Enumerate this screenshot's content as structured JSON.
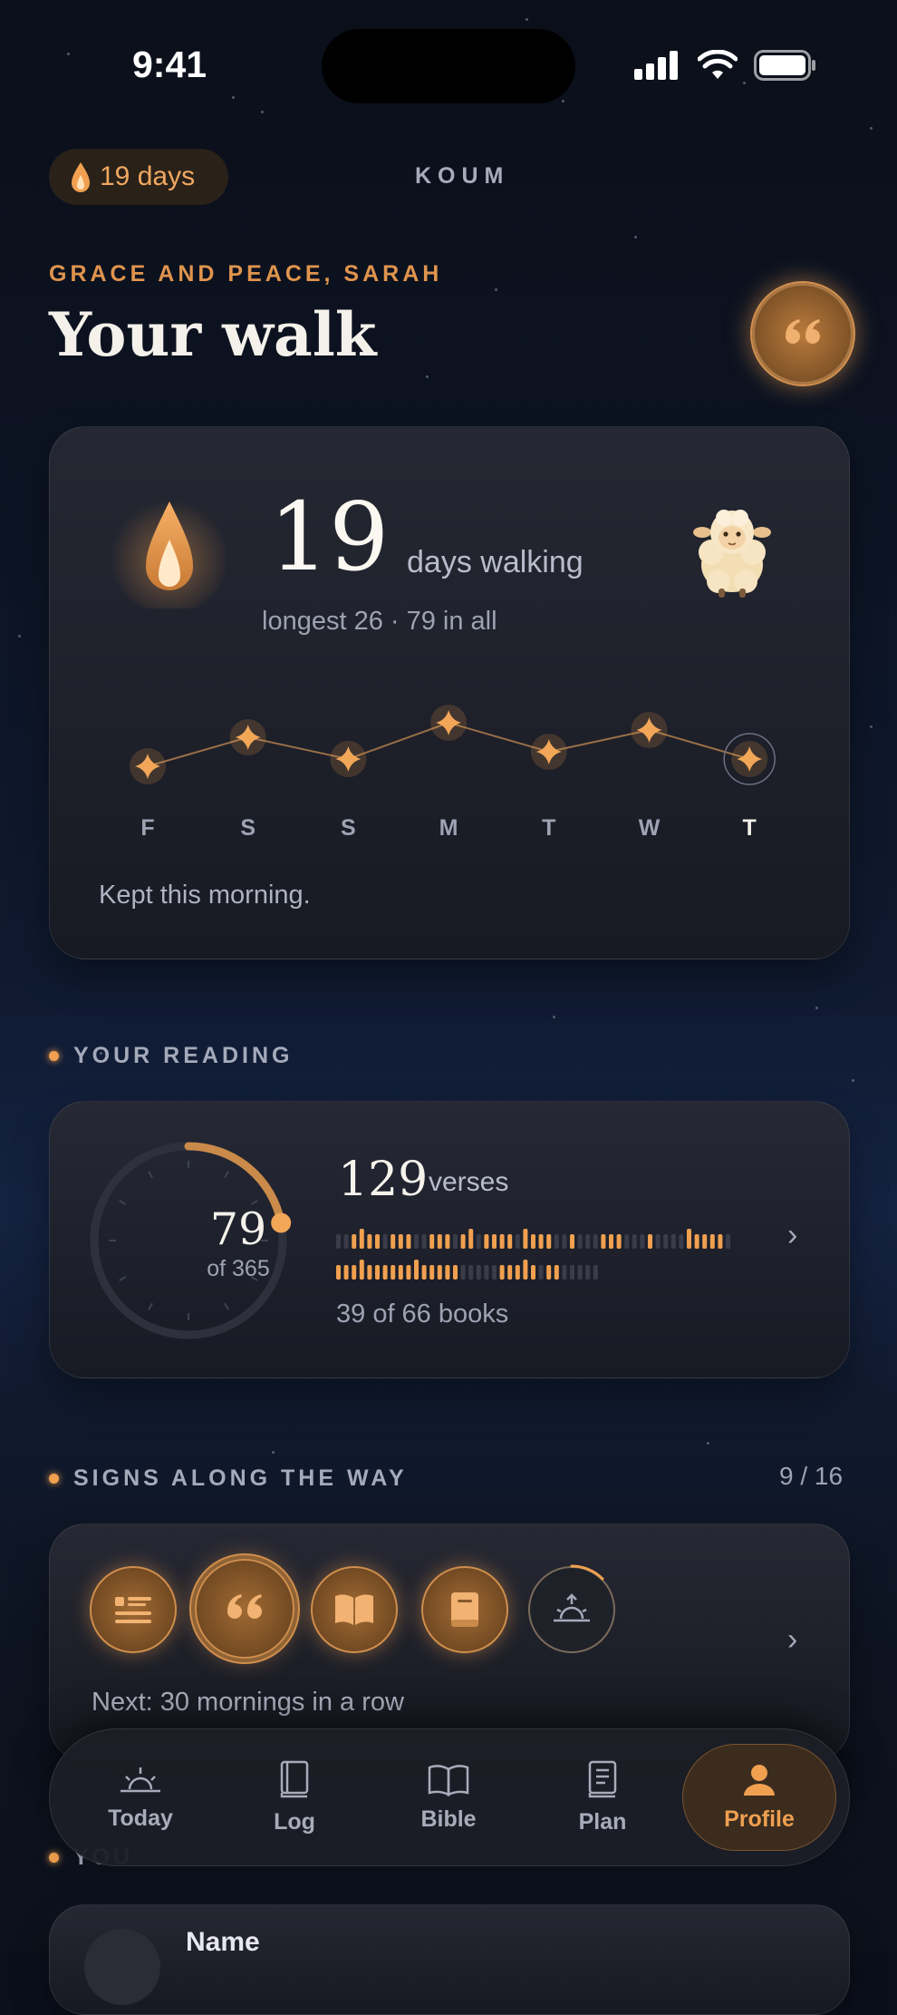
{
  "status_bar": {
    "time": "9:41"
  },
  "header": {
    "streak_label": "19 days",
    "brand": "KOUM",
    "greeting": "GRACE AND PEACE, SARAH",
    "title": "Your walk"
  },
  "walk_card": {
    "streak_number": "19",
    "streak_label": "days walking",
    "subtitle": "longest 26 · 79 in all",
    "days": [
      {
        "label": "F",
        "value": 1
      },
      {
        "label": "S",
        "value": 3
      },
      {
        "label": "S",
        "value": 1.5
      },
      {
        "label": "M",
        "value": 4
      },
      {
        "label": "T",
        "value": 2
      },
      {
        "label": "W",
        "value": 3.5
      },
      {
        "label": "T",
        "value": 1.5,
        "today": true
      }
    ],
    "status_text": "Kept this morning."
  },
  "reading": {
    "section_label": "YOUR READING",
    "days_read": "79",
    "days_total": "of 365",
    "progress_fraction": 0.22,
    "verses_count": "129",
    "verses_label": "verses",
    "books_text": "39 of 66 books"
  },
  "signs": {
    "section_label": "SIGNS ALONG THE WAY",
    "count": "9 / 16",
    "badges": [
      "list-icon",
      "quote-icon",
      "open-book-icon",
      "closed-book-icon",
      "sunrise-icon"
    ],
    "next_text": "Next: 30 mornings in a row"
  },
  "nav": {
    "items": [
      {
        "label": "Today",
        "icon": "sunrise-icon"
      },
      {
        "label": "Log",
        "icon": "book-icon"
      },
      {
        "label": "Bible",
        "icon": "open-book-icon"
      },
      {
        "label": "Plan",
        "icon": "plan-icon"
      },
      {
        "label": "Profile",
        "icon": "person-icon",
        "active": true
      }
    ]
  },
  "you": {
    "section_label": "YOU",
    "name_label": "Name"
  },
  "colors": {
    "accent": "#f0a050",
    "background": "#0c1322"
  }
}
